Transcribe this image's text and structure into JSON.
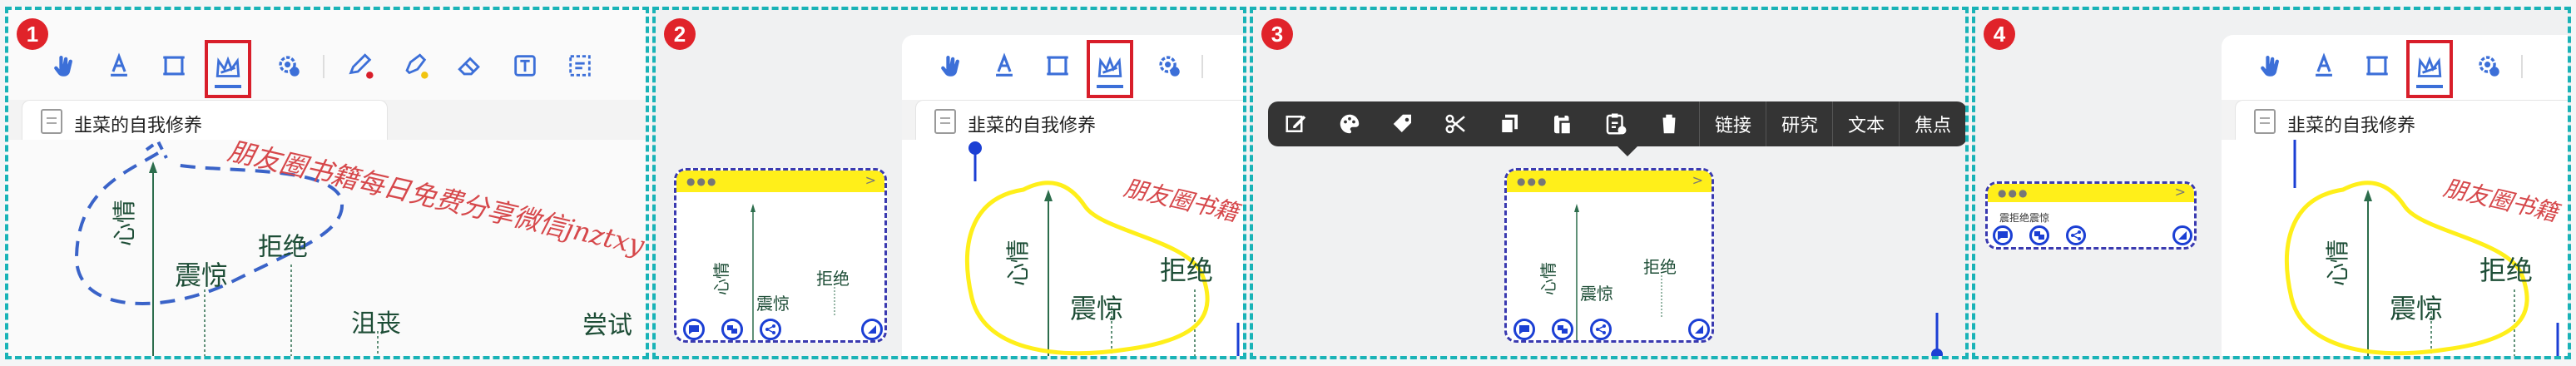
{
  "steps": [
    "1",
    "2",
    "3",
    "4"
  ],
  "document": {
    "title": "韭菜的自我修养"
  },
  "watermark": "朋友圈书籍每日免费分享微信jnztxy",
  "watermark_partial_p2": "朋友圈书籍",
  "watermark_partial_p4": "朋友圈书籍",
  "mindmap": {
    "words": [
      "心情",
      "震惊",
      "拒绝",
      "沮丧",
      "尝试"
    ]
  },
  "mini_node": {
    "text": "震拒绝震惊"
  },
  "context_menu": {
    "icons": [
      "edit-icon",
      "palette-icon",
      "tag-icon",
      "scissors-icon",
      "copy-icon",
      "paste-icon",
      "paste-special-icon",
      "trash-icon"
    ],
    "text_items": [
      "链接",
      "研究",
      "文本",
      "焦点"
    ]
  },
  "toolbar_icons": [
    "hand-icon",
    "text-underline-icon",
    "crop-frame-icon",
    "lasso-icon",
    "settings-gear-icon",
    "pen-icon",
    "highlighter-icon",
    "eraser-icon",
    "textbox-icon",
    "select-box-icon"
  ],
  "colors": {
    "panel_border": "#19b3b7",
    "highlight_box": "#d81e2a",
    "selection_blue": "#1b3fd4",
    "lasso_yellow": "#ffef1a",
    "badge_red": "#e0232a"
  }
}
